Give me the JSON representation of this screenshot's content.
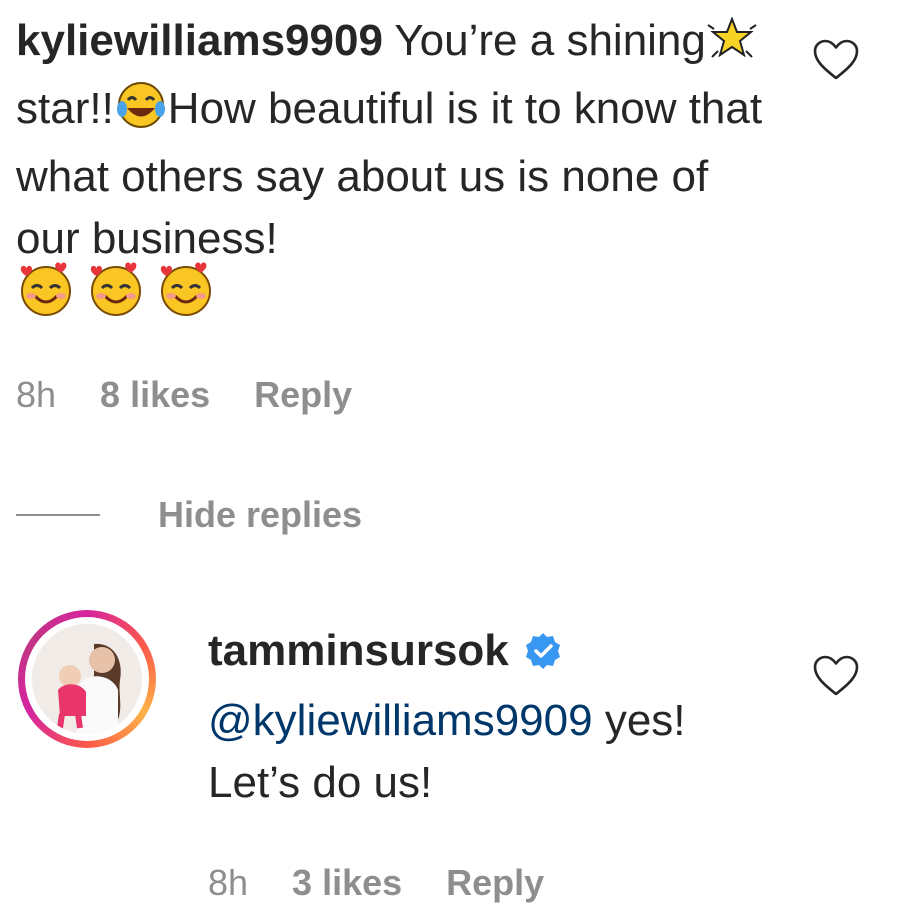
{
  "comment": {
    "username": "kyliewilliams9909",
    "text_1": "You’re a shining",
    "text_2": "star!!",
    "text_3": "How beautiful is it to know that what others say about us is none of our business!",
    "emoji_star": "glowing-star-icon",
    "emoji_laugh": "tears-of-joy-icon",
    "emoji_hearts": [
      "smiling-face-with-hearts-icon",
      "smiling-face-with-hearts-icon",
      "smiling-face-with-hearts-icon"
    ],
    "time": "8h",
    "likes": "8 likes",
    "reply_label": "Reply"
  },
  "hide_replies_label": "Hide replies",
  "reply": {
    "username": "tamminsursok",
    "verified_icon": "verified-badge-icon",
    "mention": "@kyliewilliams9909",
    "text_1": "yes!",
    "text_2": "Let’s do us!",
    "time": "8h",
    "likes": "3 likes",
    "reply_label": "Reply"
  },
  "colors": {
    "text": "#262626",
    "muted": "#8e8e8e",
    "mention": "#00376b",
    "verified": "#3897f0"
  }
}
